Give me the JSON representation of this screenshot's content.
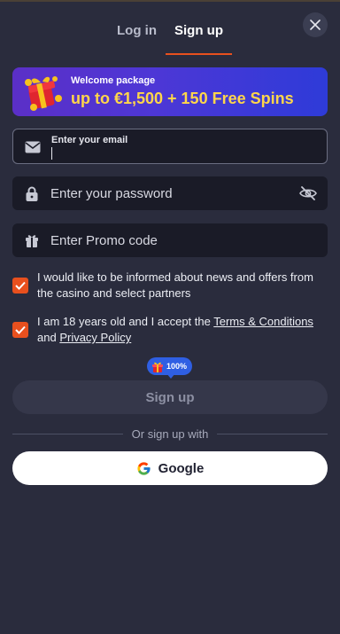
{
  "tabs": {
    "login": "Log in",
    "signup": "Sign up"
  },
  "banner": {
    "title": "Welcome package",
    "offer": "up to €1,500 + 150 Free Spins"
  },
  "fields": {
    "email": {
      "label": "Enter your email",
      "value": ""
    },
    "password": {
      "placeholder": "Enter your password"
    },
    "promo": {
      "placeholder": "Enter Promo code"
    }
  },
  "checks": {
    "news": {
      "text": "I would like to be informed about news and offers from the casino and select partners",
      "checked": true
    },
    "age": {
      "prefix": "I am 18 years old and I accept the ",
      "terms": "Terms & Conditions",
      "and": " and ",
      "privacy": "Privacy Policy",
      "checked": true
    }
  },
  "badge": {
    "percent": "100%"
  },
  "buttons": {
    "signup": "Sign up",
    "google": "Google"
  },
  "divider": {
    "text": "Or sign up with"
  },
  "colors": {
    "accent": "#e8501e",
    "background": "#2a2c3d",
    "field": "#1a1b27",
    "offer": "#ffd64a",
    "badge": "#2f5fe3"
  }
}
